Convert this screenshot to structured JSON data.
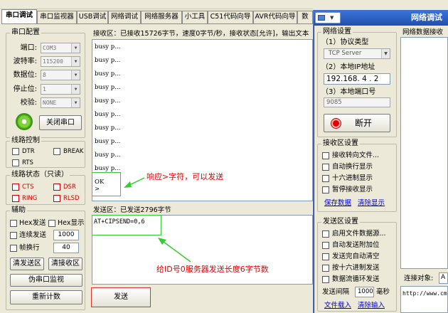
{
  "titlebar": {
    "partial_text": "——————————"
  },
  "tabs": [
    "串口调试",
    "串口监视器",
    "USB调试",
    "网络调试",
    "网络服务器",
    "小工具",
    "C51代码向导",
    "AVR代码向导",
    "数"
  ],
  "serial_config": {
    "title": "串口配置",
    "fields": [
      {
        "label": "端口:",
        "value": "COM3"
      },
      {
        "label": "波特率:",
        "value": "115200"
      },
      {
        "label": "数据位:",
        "value": "8"
      },
      {
        "label": "停止位:",
        "value": "1"
      },
      {
        "label": "校验:",
        "value": "NONE"
      }
    ],
    "close_button": "关闭串口"
  },
  "line_control": {
    "title": "线路控制",
    "dtr": "DTR",
    "break": "BREAK",
    "rts": "RTS"
  },
  "line_status": {
    "title": "线路状态（只读）",
    "cts": "CTS",
    "dsr": "DSR",
    "ring": "RING",
    "rlsd": "RLSD"
  },
  "aux": {
    "title": "辅助",
    "hex_send": "Hex发送",
    "hex_display": "Hex显示",
    "continuous_send": "连续发送",
    "continuous_value": "1000",
    "frame_newline": "帧换行",
    "frame_value": "40",
    "clear_send": "清发送区",
    "clear_receive": "清接收区",
    "fake_monitor": "伪串口监视",
    "recount": "重新计数"
  },
  "receive": {
    "header": "接收区：已接收15726字节，速度0字节/秒，接收状态[允许]，输出文本",
    "lines": [
      "busy p...",
      "busy p...",
      "busy p...",
      "busy p...",
      "busy p...",
      "busy p...",
      "busy p...",
      "busy p...",
      "busy p...",
      "busy p...",
      "OK",
      ">"
    ]
  },
  "annotation_1": "响应>字符，可以发送",
  "send": {
    "header": "发送区：已发送2796字节",
    "text": "AT+CIPSEND=0,6",
    "button": "发送"
  },
  "annotation_2": "给ID号0服务器发送长度6字节数",
  "network_window": {
    "title": "网络调试",
    "settings_title": "网络设置",
    "protocol_label": "（1）协议类型",
    "protocol_value": "TCP Server",
    "ip_label": "（2）本地IP地址",
    "ip_value": "192.168. 4 . 2",
    "port_label": "（3）本地端口号",
    "port_value": "9085",
    "disconnect": "断开",
    "rx_settings_title": "接收区设置",
    "rx_options": [
      "接收转向文件...",
      "自动换行显示",
      "十六进制显示",
      "暂停接收显示"
    ],
    "save_data": "保存数据",
    "clear_display": "清除显示",
    "tx_settings_title": "发送区设置",
    "tx_options": [
      "启用文件数据源...",
      "自动发送附加位",
      "发送完自动清空",
      "按十六进制发送",
      "数据流循环发送"
    ],
    "interval_label": "发送间隔",
    "interval_value": "1000",
    "interval_unit": "毫秒",
    "file_load": "文件载入",
    "clear_input": "清除输入",
    "data_receive_title": "网络数据接收",
    "connect_label": "连接对象:",
    "connect_value": "A",
    "url_text": "http://www.cmsoft"
  },
  "colors": {
    "annotation": "#e60000",
    "highlight_box": "#33cc33",
    "window_bg": "#ece9d8",
    "title_blue": "#2a5db8"
  }
}
